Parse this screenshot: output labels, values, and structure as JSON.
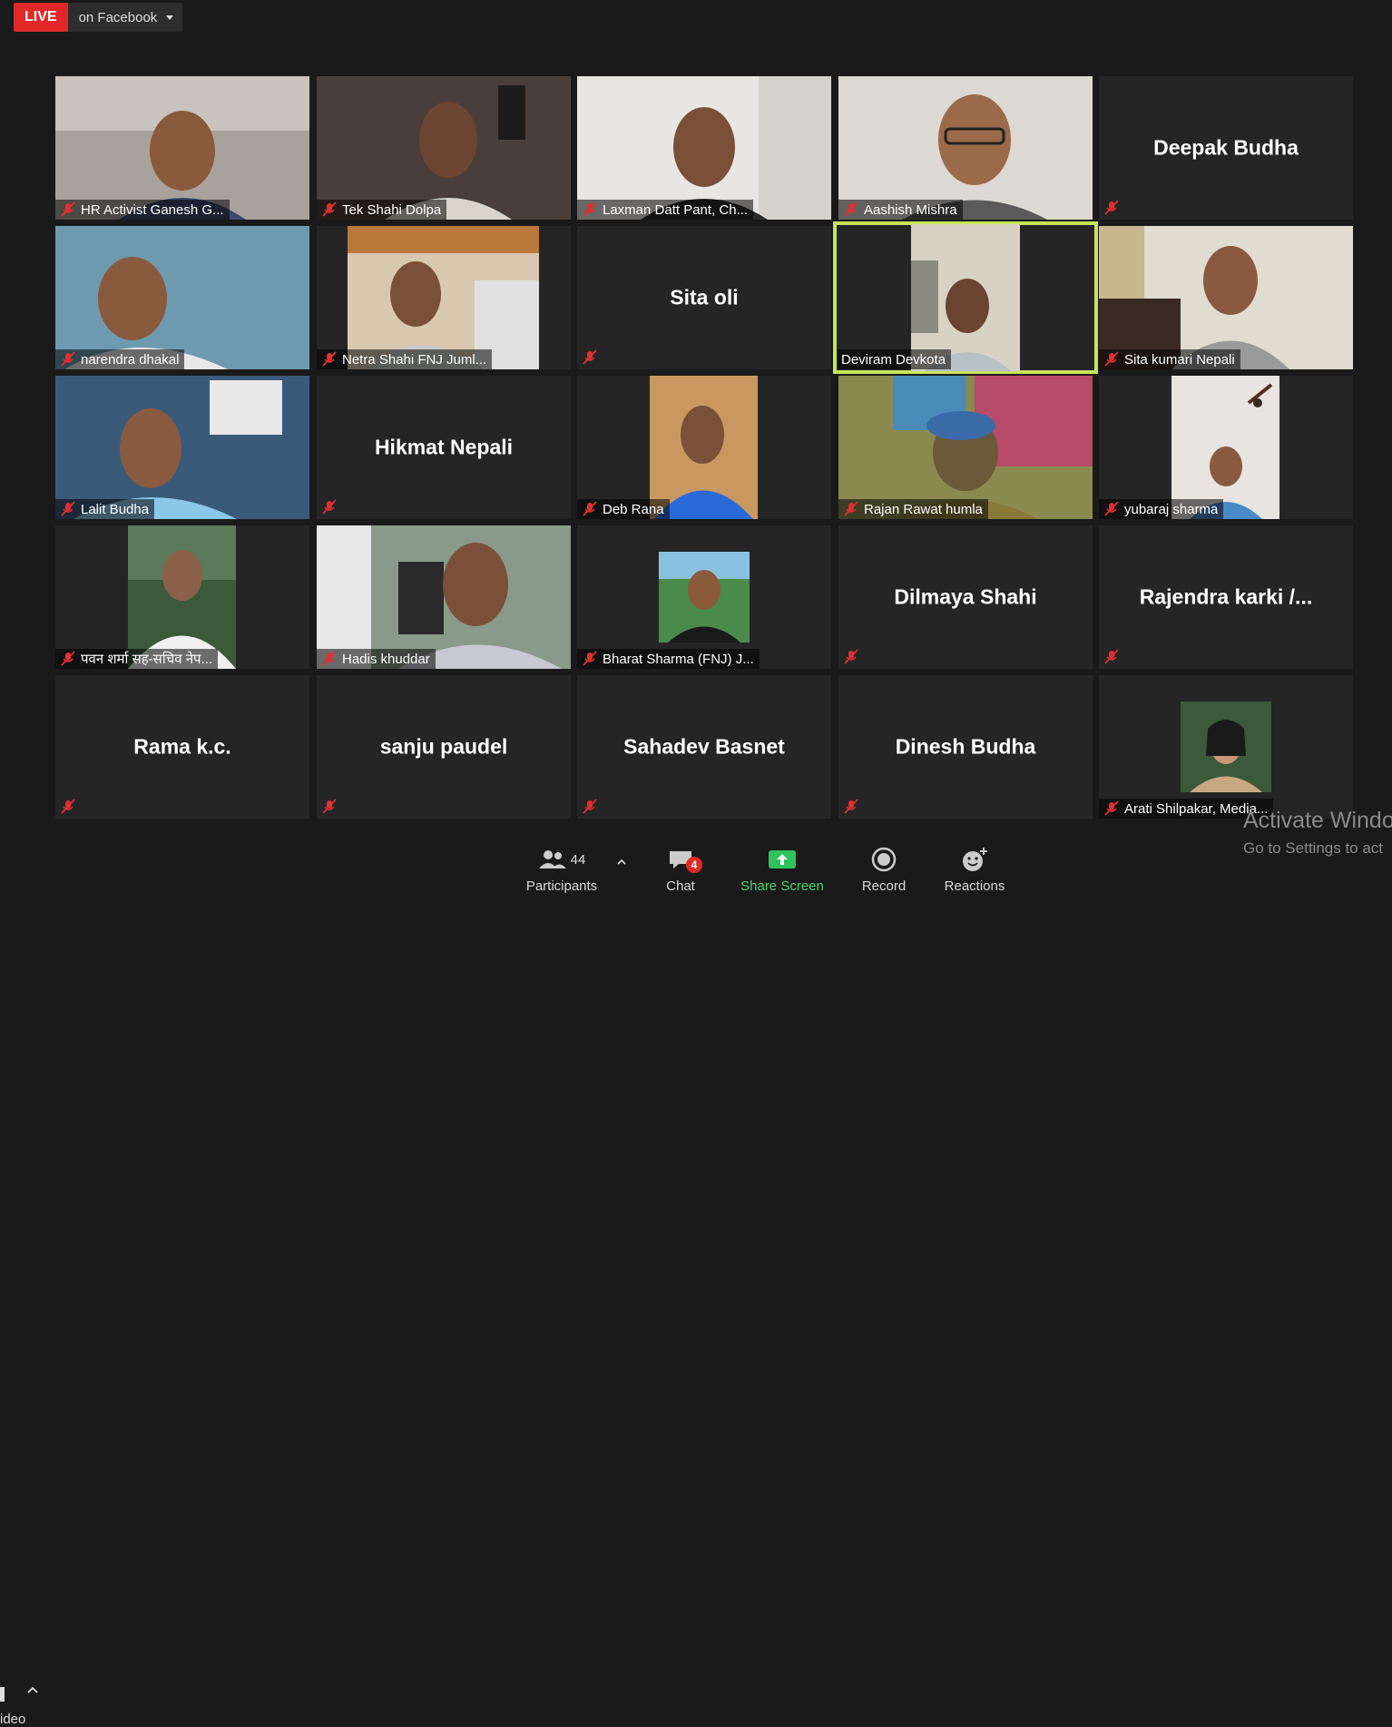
{
  "live": {
    "badge": "LIVE",
    "destination": "on Facebook"
  },
  "participants": [
    {
      "name": "HR Activist Ganesh G...",
      "video": true
    },
    {
      "name": "Tek Shahi Dolpa",
      "video": true
    },
    {
      "name": "Laxman Datt Pant, Ch...",
      "video": true
    },
    {
      "name": "Aashish Mishra",
      "video": true
    },
    {
      "name": "",
      "display_name": "Deepak Budha",
      "video": false
    },
    {
      "name": "narendra dhakal",
      "video": true
    },
    {
      "name": "Netra  Shahi FNJ Juml...",
      "video": true
    },
    {
      "name": "",
      "display_name": "Sita oli",
      "video": false
    },
    {
      "name": "Deviram Devkota",
      "video": true,
      "active_speaker": true
    },
    {
      "name": "Sita kumari Nepali",
      "video": true
    },
    {
      "name": "Lalit Budha",
      "video": true
    },
    {
      "name": "",
      "display_name": "Hikmat Nepali",
      "video": false
    },
    {
      "name": "Deb Rana",
      "video": true
    },
    {
      "name": "Rajan Rawat humla",
      "video": true
    },
    {
      "name": "yubaraj sharma",
      "video": true
    },
    {
      "name": "पवन शर्मा सह-सचिव नेप...",
      "video": true
    },
    {
      "name": "Hadis khuddar",
      "video": true
    },
    {
      "name": "Bharat Sharma (FNJ) J...",
      "video": true
    },
    {
      "name": "",
      "display_name": "Dilmaya Shahi",
      "video": false
    },
    {
      "name": "",
      "display_name": "Rajendra  karki  /...",
      "video": false
    },
    {
      "name": "",
      "display_name": "Rama k.c.",
      "video": false
    },
    {
      "name": "",
      "display_name": "sanju paudel",
      "video": false
    },
    {
      "name": "",
      "display_name": "Sahadev Basnet",
      "video": false
    },
    {
      "name": "",
      "display_name": "Dinesh Budha",
      "video": false
    },
    {
      "name": "Arati Shilpakar, Media...",
      "video": true
    }
  ],
  "toolbar": {
    "left_label": "ideo",
    "participants_label": "Participants",
    "participants_count": "44",
    "chat_label": "Chat",
    "chat_badge": "4",
    "share_label": "Share Screen",
    "record_label": "Record",
    "reactions_label": "Reactions"
  },
  "watermark": {
    "line1": "Activate Windo",
    "line2": "Go to Settings to act"
  },
  "colors": {
    "live": "#e02828",
    "active_border": "#c9e35b",
    "share": "#4bd36a",
    "tile_bg": "#252525"
  }
}
